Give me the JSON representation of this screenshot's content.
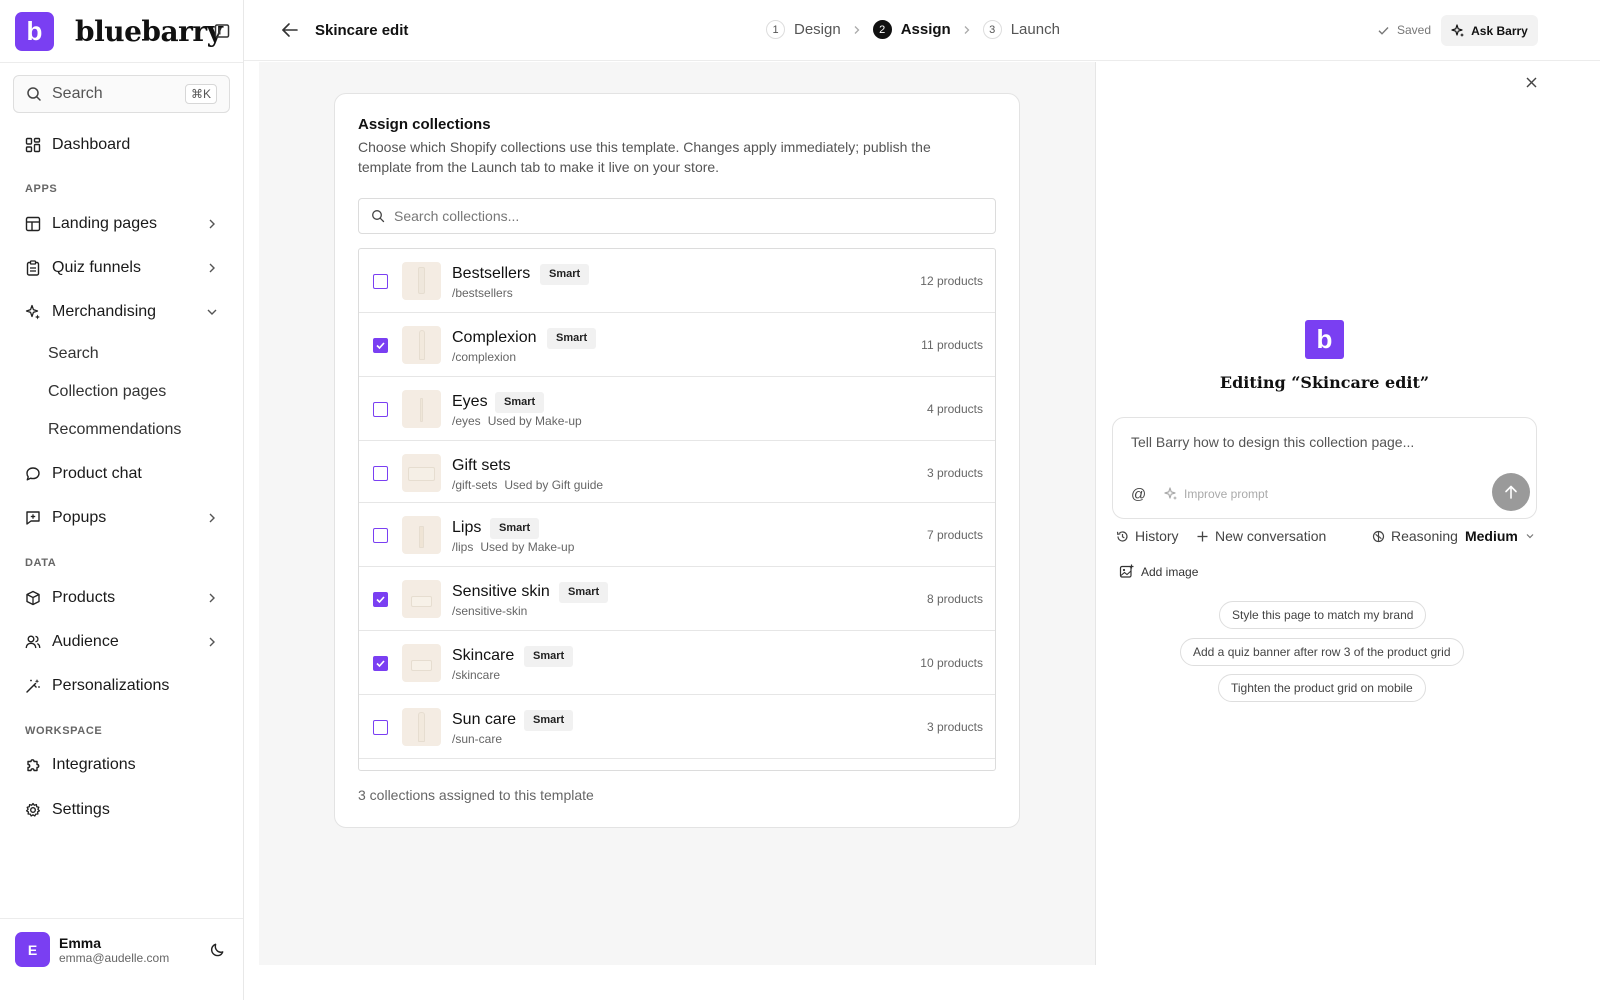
{
  "sidebar": {
    "brand": {
      "logo_letter": "b",
      "name": "bluebarry",
      "color": "#7a3ff2"
    },
    "search": {
      "placeholder": "Search",
      "shortcut": "⌘K"
    },
    "dashboard": "Dashboard",
    "sections": {
      "apps": "APPS",
      "data": "DATA",
      "workspace": "WORKSPACE"
    },
    "apps": {
      "landing_pages": "Landing pages",
      "quiz_funnels": "Quiz funnels",
      "merchandising": "Merchandising",
      "merch_sub": [
        "Search",
        "Collection pages",
        "Recommendations"
      ],
      "product_chat": "Product chat",
      "popups": "Popups"
    },
    "data": {
      "products": "Products",
      "audience": "Audience",
      "personalizations": "Personalizations"
    },
    "workspace": {
      "integrations": "Integrations",
      "settings": "Settings"
    },
    "user": {
      "initial": "E",
      "name": "Emma",
      "email": "emma@audelle.com"
    }
  },
  "topbar": {
    "title": "Skincare edit",
    "steps": [
      {
        "num": "1",
        "label": "Design"
      },
      {
        "num": "2",
        "label": "Assign"
      },
      {
        "num": "3",
        "label": "Launch"
      }
    ],
    "active_step": "Assign",
    "saved": "Saved",
    "ask_button": "Ask Barry"
  },
  "card": {
    "title": "Assign collections",
    "description": "Choose which Shopify collections use this template. Changes apply immediately; publish the template from the Launch tab to make it live on your store.",
    "search_placeholder": "Search collections...",
    "rows": [
      {
        "name": "Bestsellers",
        "badge": "Smart",
        "handle": "/bestsellers",
        "used_by": "",
        "count": "12 products",
        "checked": false
      },
      {
        "name": "Complexion",
        "badge": "Smart",
        "handle": "/complexion",
        "used_by": "",
        "count": "11 products",
        "checked": true
      },
      {
        "name": "Eyes",
        "badge": "Smart",
        "handle": "/eyes",
        "used_by": "Used by Make-up",
        "count": "4 products",
        "checked": false
      },
      {
        "name": "Gift sets",
        "badge": "",
        "handle": "/gift-sets",
        "used_by": "Used by Gift guide",
        "count": "3 products",
        "checked": false
      },
      {
        "name": "Lips",
        "badge": "Smart",
        "handle": "/lips",
        "used_by": "Used by Make-up",
        "count": "7 products",
        "checked": false
      },
      {
        "name": "Sensitive skin",
        "badge": "Smart",
        "handle": "/sensitive-skin",
        "used_by": "",
        "count": "8 products",
        "checked": true
      },
      {
        "name": "Skincare",
        "badge": "Smart",
        "handle": "/skincare",
        "used_by": "",
        "count": "10 products",
        "checked": true
      },
      {
        "name": "Sun care",
        "badge": "Smart",
        "handle": "/sun-care",
        "used_by": "",
        "count": "3 products",
        "checked": false
      }
    ],
    "footer": "3 collections assigned to this template"
  },
  "panel": {
    "logo_letter": "b",
    "editing_title": "Editing “Skincare edit”",
    "prompt_placeholder": "Tell Barry how to design this collection page...",
    "at_symbol": "@",
    "improve_prompt": "Improve prompt",
    "history": "History",
    "new_conversation": "New conversation",
    "reasoning_label": "Reasoning",
    "reasoning_value": "Medium",
    "add_image": "Add image",
    "suggestions": [
      "Style this page to match my brand",
      "Add a quiz banner after row 3 of the product grid",
      "Tighten the product grid on mobile"
    ]
  }
}
